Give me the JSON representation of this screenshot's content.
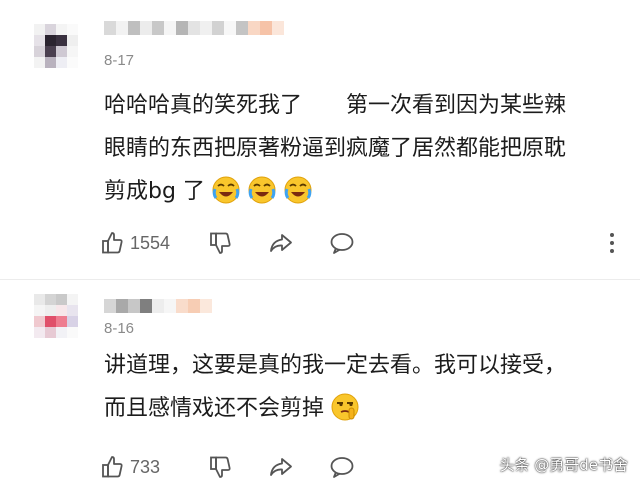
{
  "comments": [
    {
      "date": "8-17",
      "line1": "哈哈哈真的笑死我了　　第一次看到因为某些辣",
      "line2": "眼睛的东西把原著粉逼到疯魔了居然都能把原耽",
      "line3": "剪成bg 了",
      "emojis": [
        "laugh-cry-emoji",
        "laugh-cry-emoji",
        "laugh-cry-emoji"
      ],
      "likes": "1554"
    },
    {
      "date": "8-16",
      "line1": "讲道理，这要是真的我一定去看。我可以接受，",
      "line2": "而且感情戏还不会剪掉",
      "emojis": [
        "smirk-shush-emoji"
      ],
      "likes": "733"
    }
  ],
  "watermark": "头条 @勇哥de书舍",
  "colors": {
    "text": "#1c1c1c",
    "meta": "#8a8a8a",
    "icon": "#555555"
  }
}
